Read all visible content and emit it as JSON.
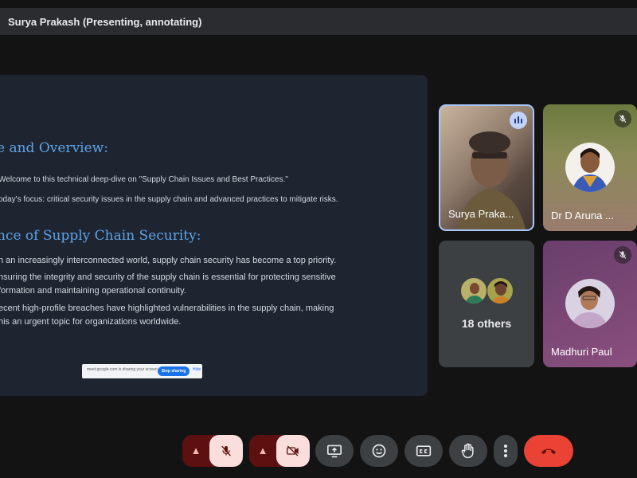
{
  "window": {
    "title": "Surya Prakash (Presenting, annotating)"
  },
  "slide": {
    "heading1": "e and Overview:",
    "bullets1": [
      "Welcome to this technical deep-dive on \"Supply Chain Issues and Best Practices.\"",
      "oday's focus: critical security issues in the supply chain and advanced practices to mitigate risks."
    ],
    "heading2": "nce of Supply Chain Security:",
    "bullets2": [
      "n an increasingly interconnected world, supply chain security has become a top priority.",
      "nsuring the integrity and security of the supply chain is essential for protecting sensitive\nformation and maintaining operational continuity.",
      "ecent high-profile breaches have highlighted vulnerabilities in the supply chain, making\nhis an urgent topic for organizations worldwide."
    ],
    "share_banner": {
      "text": "meet.google.com is sharing your screen",
      "stop_label": "Stop sharing",
      "hide_label": "Hide"
    }
  },
  "participants": [
    {
      "name": "Surya Praka...",
      "state": "speaking"
    },
    {
      "name": "Dr D Aruna ...",
      "state": "muted"
    },
    {
      "name": "18 others",
      "state": "group"
    },
    {
      "name": "Madhuri Paul",
      "state": "muted"
    }
  ],
  "controls": {
    "mic_icon": "mic-off-icon",
    "camera_icon": "camera-off-icon",
    "present_icon": "present-screen-icon",
    "emoji_icon": "emoji-icon",
    "captions_icon": "captions-icon",
    "hand_icon": "raise-hand-icon",
    "more_icon": "more-vert-icon",
    "end_icon": "end-call-icon"
  },
  "colors": {
    "background": "#131314",
    "accent": "#a8c7fa",
    "danger": "#ea4335",
    "heading": "#5da4e8"
  }
}
